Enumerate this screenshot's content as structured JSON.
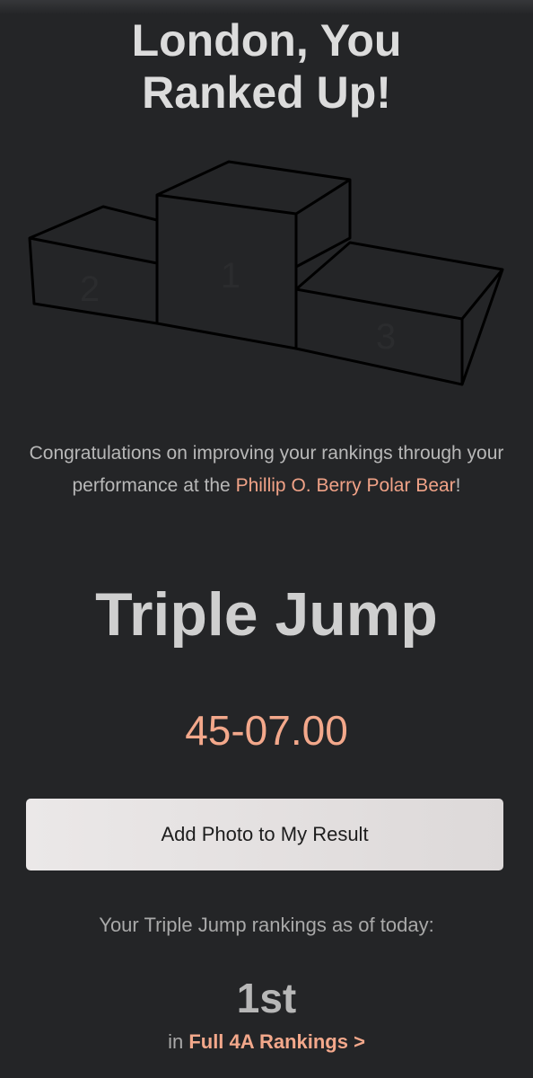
{
  "header": {
    "title_line1": "London, You",
    "title_line2": "Ranked Up!"
  },
  "podium": {
    "places": [
      "2",
      "1",
      "3"
    ]
  },
  "message": {
    "prefix": "Congratulations on improving your rankings through your performance at the ",
    "meet_name": "Phillip O. Berry Polar Bear",
    "suffix": "!"
  },
  "result": {
    "event": "Triple Jump",
    "mark": "45-07.00"
  },
  "actions": {
    "add_photo_label": "Add Photo to My Result"
  },
  "rankings": {
    "caption": "Your Triple Jump rankings as of today:",
    "position": "1st",
    "scope_prefix": "in ",
    "scope_link": "Full 4A Rankings >"
  },
  "colors": {
    "background": "#242527",
    "accent": "#f3a88b",
    "button": "#e6e3e3"
  }
}
